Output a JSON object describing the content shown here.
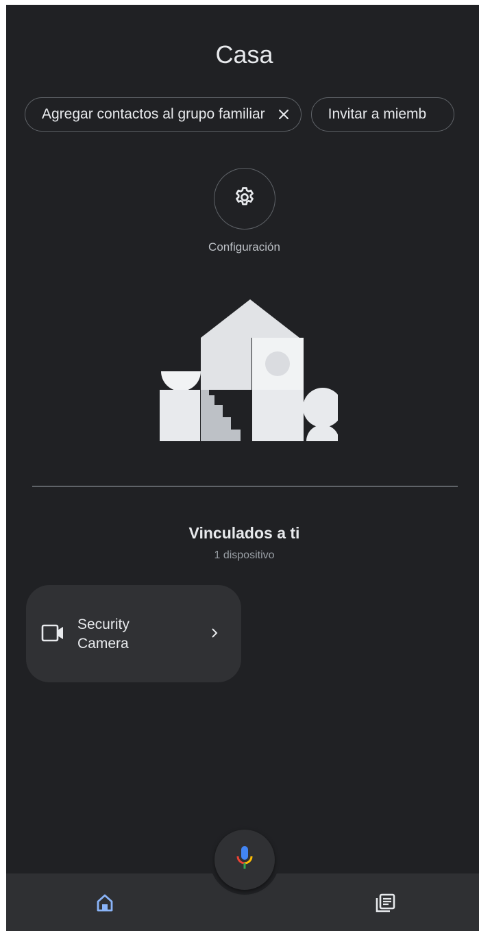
{
  "header": {
    "title": "Casa"
  },
  "chips": [
    {
      "label": "Agregar contactos al grupo familiar",
      "icon": "close-icon"
    },
    {
      "label": "Invitar a miemb"
    }
  ],
  "settings": {
    "label": "Configuración",
    "icon": "gear-icon"
  },
  "linked_section": {
    "title": "Vinculados a ti",
    "subtitle": "1 dispositivo"
  },
  "device": {
    "name": "Security Camera",
    "icon": "camera-icon"
  },
  "bottom_nav": {
    "items": [
      {
        "icon": "home-icon",
        "active": true
      },
      {
        "icon": "feed-icon",
        "active": false
      }
    ],
    "mic_icon": "mic-icon"
  },
  "colors": {
    "background": "#202124",
    "card": "#303134",
    "nav_bar": "#2f3033",
    "accent_blue": "#8ab4f8",
    "mic_blue": "#4285f4",
    "mic_red": "#ea4335",
    "mic_yellow": "#fbbc04",
    "mic_green": "#34a853"
  }
}
